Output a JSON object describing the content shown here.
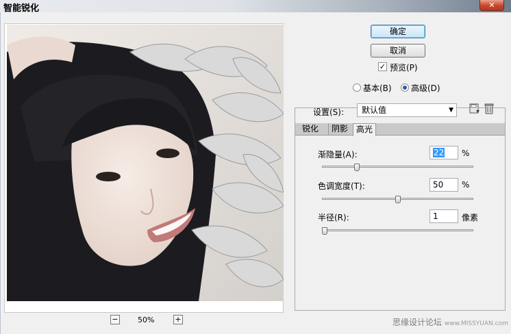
{
  "window": {
    "title": "智能锐化",
    "close_label": "✕"
  },
  "buttons": {
    "ok": "确定",
    "cancel": "取消"
  },
  "preview_checkbox": {
    "label": "预览(P)",
    "checked": true
  },
  "mode": {
    "basic": "基本(B)",
    "advanced": "高级(D)",
    "selected": "advanced"
  },
  "settings": {
    "label": "设置(S):",
    "value": "默认值"
  },
  "tabs": [
    "锐化",
    "阴影",
    "高光"
  ],
  "active_tab": "高光",
  "sliders": [
    {
      "label": "渐隐量(A):",
      "value": "22",
      "unit": "%",
      "level": 0.22
    },
    {
      "label": "色调宽度(T):",
      "value": "50",
      "unit": "%",
      "level": 0.5
    },
    {
      "label": "半径(R):",
      "value": "1",
      "unit": "像素",
      "level": 0.0
    }
  ],
  "zoom": {
    "minus": "−",
    "plus": "+",
    "level": "50%"
  },
  "watermark": {
    "text": "思缘设计论坛",
    "url": "www.MISSYUAN.com"
  }
}
